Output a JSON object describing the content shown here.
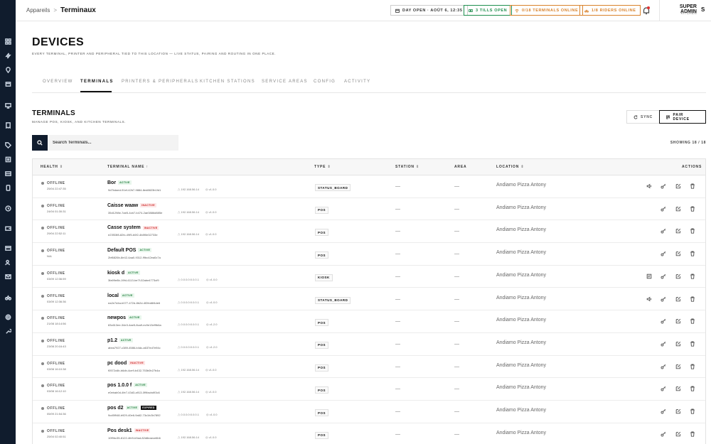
{
  "breadcrumb": {
    "parent": "Appareils",
    "separator": ">",
    "current": "Terminaux"
  },
  "topbar": {
    "day_status": "DAY OPEN · AOÛT 6, 12:35",
    "tills": "3 TILLS OPEN",
    "terminals_online": "0/18 TERMINALS ONLINE",
    "riders_online": "1/8 RIDERS ONLINE",
    "user_name": "SUPER ADMIN",
    "user_role": "KITCHEN",
    "avatar_letter": "S"
  },
  "page": {
    "title": "DEVICES",
    "subtitle": "EVERY TERMINAL, PRINTER AND PERIPHERAL TIED TO THIS LOCATION — LIVE STATUS, PAIRING AND ROUTING IN ONE PLACE."
  },
  "tabs": [
    "OVERVIEW",
    "TERMINALS",
    "PRINTERS & PERIPHERALS",
    "KITCHEN STATIONS",
    "SERVICE AREAS",
    "CONFIG",
    "ACTIVITY"
  ],
  "active_tab": "TERMINALS",
  "section": {
    "title": "TERMINALS",
    "subtitle": "MANAGE POS, KIOSK, AND KITCHEN TERMINALS.",
    "sync_label": "SYNC",
    "pair_label": "PAIR DEVICE",
    "search_placeholder": "Search Terminals...",
    "showing": "SHOWING 18 / 18"
  },
  "columns": {
    "health": "HEALTH",
    "name": "TERMINAL NAME",
    "type": "TYPE",
    "station": "STATION",
    "area": "AREA",
    "location": "LOCATION",
    "actions": "ACTIONS"
  },
  "sort_icons": {
    "neutral": "⇕",
    "asc": "↑"
  },
  "dash": "—",
  "rows": [
    {
      "health": "OFFLINE",
      "time": "25/04 22:47:35",
      "name": "Bor",
      "status": "ACTIVE",
      "id": "9d7bdaed-91ef-42b7-9884-8ed8823b1fd1",
      "ip": "192.168.56.14",
      "version": "v1.0.0",
      "type": "STATUS_BOARD",
      "location": "Andiamo Pizza Antony",
      "extra": "speaker"
    },
    {
      "health": "OFFLINE",
      "time": "24/04 01:30:31",
      "name": "Caisse waaw",
      "status": "INACTIVE",
      "id": "35d1298e-7ae5-4cb7-b474-2ae3886d885e",
      "ip": "192.168.56.14",
      "version": "v1.0.0",
      "type": "POS",
      "location": "Andiamo Pizza Antony",
      "extra": ""
    },
    {
      "health": "OFFLINE",
      "time": "29/04 22:52:11",
      "name": "Casse system",
      "status": "INACTIVE",
      "id": "e23f33f8-82fc-49f5-b0f2-4b8f0e32733e",
      "ip": "192.168.56.14",
      "version": "v1.0.0",
      "type": "POS",
      "location": "Andiamo Pizza Antony",
      "extra": ""
    },
    {
      "health": "OFFLINE",
      "time": "N/A",
      "name": "Default POS",
      "status": "ACTIVE",
      "id": "2bf6826b-8e42-4aa0-9312-f9bc42ea0c7a",
      "ip": "",
      "version": "",
      "type": "POS",
      "location": "Andiamo Pizza Antony",
      "extra": ""
    },
    {
      "health": "OFFLINE",
      "time": "03/09 12:36:59",
      "name": "kiosk d",
      "status": "ACTIVE",
      "id": "3fa99e8b-19fd-4113-be7f-02abe4773cf9",
      "ip": "0.0.0.0:0.0.0.1",
      "version": "v1.0.0",
      "type": "KIOSK",
      "location": "Andiamo Pizza Antony",
      "extra": "kiosk"
    },
    {
      "health": "OFFLINE",
      "time": "03/09 12:36:36",
      "name": "local",
      "status": "ACTIVE",
      "id": "ea2e7d4a-b077-472d-8b2d-4f2fed6f4de6",
      "ip": "0.0.0.0:0.0.0.1",
      "version": "v1.0.0",
      "type": "STATUS_BOARD",
      "location": "Andiamo Pizza Antony",
      "extra": "speaker"
    },
    {
      "health": "OFFLINE",
      "time": "21/08 18:14:56",
      "name": "newpos",
      "status": "ACTIVE",
      "id": "83c613ee-34e3-4ae5-8ca9-ec9e13ef9b6a",
      "ip": "0.0.0.0:0.0.0.1",
      "version": "v1.2.0",
      "type": "POS",
      "location": "Andiamo Pizza Antony",
      "extra": ""
    },
    {
      "health": "OFFLINE",
      "time": "23/08 20:16:43",
      "name": "p1.2",
      "status": "ACTIVE",
      "id": "abea7927-c389-4586-b4dc-a637ed7e94c",
      "ip": "0.0.0.0:0.0.0.1",
      "version": "v1.2.0",
      "type": "POS",
      "location": "Andiamo Pizza Antony",
      "extra": ""
    },
    {
      "health": "OFFLINE",
      "time": "03/08 16:10:38",
      "name": "pc dood",
      "status": "INACTIVE",
      "id": "f0572c6b-b6db-4ce9-b432-753b0b27b4a",
      "ip": "192.168.56.14",
      "version": "v1.0.0",
      "type": "POS",
      "location": "Andiamo Pizza Antony",
      "extra": ""
    },
    {
      "health": "OFFLINE",
      "time": "03/08 16:12:10",
      "name": "pos 1.0.0 f",
      "status": "ACTIVE",
      "id": "e0ebab0d-4fe7-43d3-a913-0f9facbd93c6",
      "ip": "192.168.56.14",
      "version": "v1.0.0",
      "type": "POS",
      "location": "Andiamo Pizza Antony",
      "extra": ""
    },
    {
      "health": "OFFLINE",
      "time": "05/09 21:54:36",
      "name": "pos d2",
      "status": "ACTIVE",
      "status2": "EXPIRED",
      "id": "9cd5f948-b929-40e6-9a62-73c1fc3b7892",
      "ip": "0.0.0.0:0.0.0.1",
      "version": "v1.0.0",
      "type": "POS",
      "location": "Andiamo Pizza Antony",
      "extra": ""
    },
    {
      "health": "OFFLINE",
      "time": "25/04 02:40:51",
      "name": "Pos desk1",
      "status": "INACTIVE",
      "id": "10f9bc35-8122-4fe9-b9ad-82d8eaece6b6",
      "ip": "192.168.56.14",
      "version": "v1.0.0",
      "type": "POS",
      "location": "Andiamo Pizza Antony",
      "extra": ""
    }
  ],
  "colors": {
    "sidebar": "#101c2d",
    "active_green": "#1a7a37",
    "inactive_red": "#cc2222",
    "warning_orange": "#d9822b",
    "ok_green": "#1f8f4e"
  }
}
